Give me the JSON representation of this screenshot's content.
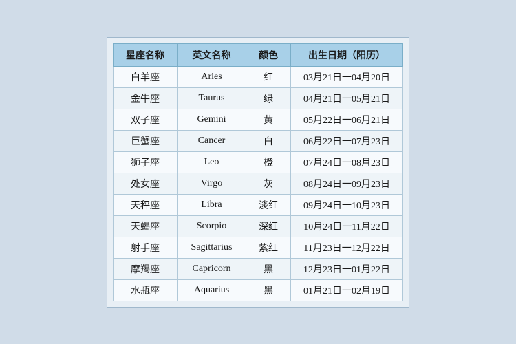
{
  "table": {
    "headers": [
      "星座名称",
      "英文名称",
      "颜色",
      "出生日期（阳历）"
    ],
    "rows": [
      {
        "cn": "白羊座",
        "en": "Aries",
        "color": "红",
        "date": "03月21日一04月20日"
      },
      {
        "cn": "金牛座",
        "en": "Taurus",
        "color": "绿",
        "date": "04月21日一05月21日"
      },
      {
        "cn": "双子座",
        "en": "Gemini",
        "color": "黄",
        "date": "05月22日一06月21日"
      },
      {
        "cn": "巨蟹座",
        "en": "Cancer",
        "color": "白",
        "date": "06月22日一07月23日"
      },
      {
        "cn": "狮子座",
        "en": "Leo",
        "color": "橙",
        "date": "07月24日一08月23日"
      },
      {
        "cn": "处女座",
        "en": "Virgo",
        "color": "灰",
        "date": "08月24日一09月23日"
      },
      {
        "cn": "天秤座",
        "en": "Libra",
        "color": "淡红",
        "date": "09月24日一10月23日"
      },
      {
        "cn": "天蝎座",
        "en": "Scorpio",
        "color": "深红",
        "date": "10月24日一11月22日"
      },
      {
        "cn": "射手座",
        "en": "Sagittarius",
        "color": "紫红",
        "date": "11月23日一12月22日"
      },
      {
        "cn": "摩羯座",
        "en": "Capricorn",
        "color": "黑",
        "date": "12月23日一01月22日"
      },
      {
        "cn": "水瓶座",
        "en": "Aquarius",
        "color": "黑",
        "date": "01月21日一02月19日"
      }
    ]
  }
}
